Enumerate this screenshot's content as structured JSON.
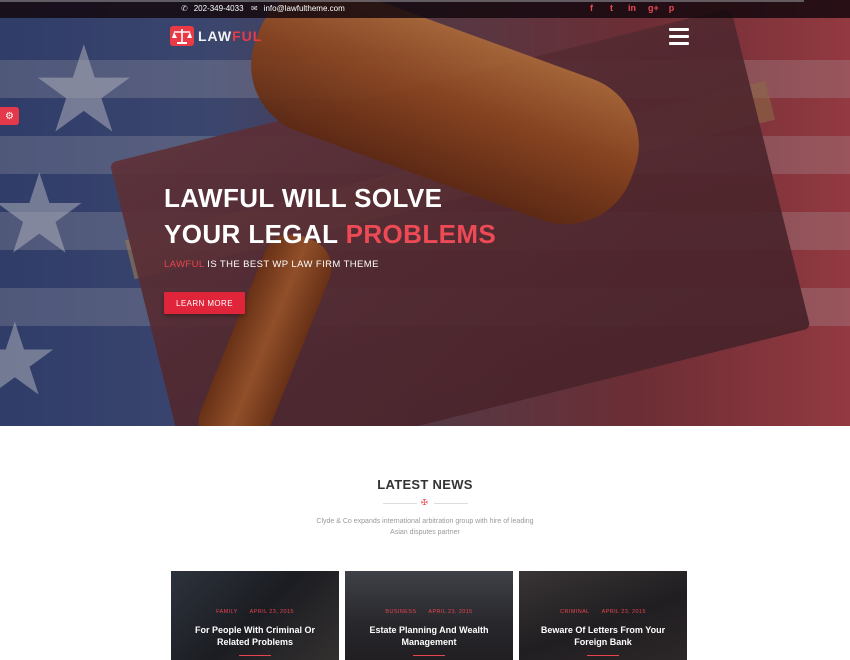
{
  "topbar": {
    "phone": "202-349-4033",
    "phone_icon": "phone-icon",
    "email": "info@lawfultheme.com",
    "email_icon": "envelope-icon",
    "social": [
      {
        "name": "facebook-icon",
        "glyph": "f"
      },
      {
        "name": "twitter-icon",
        "glyph": "t"
      },
      {
        "name": "linkedin-icon",
        "glyph": "in"
      },
      {
        "name": "google-plus-icon",
        "glyph": "g+"
      },
      {
        "name": "pinterest-icon",
        "glyph": "p"
      }
    ]
  },
  "header": {
    "logo_text_a": "LAW",
    "logo_text_b": "FUL",
    "menu_icon": "hamburger-icon"
  },
  "hero": {
    "headline_line1": "LAWFUL WILL SOLVE",
    "headline_line2_a": "YOUR LEGAL ",
    "headline_line2_b": "PROBLEMS",
    "sub_a": "LAWFUL",
    "sub_b": " IS THE BEST WP LAW FIRM THEME",
    "cta": "LEARN MORE"
  },
  "news": {
    "title": "LATEST NEWS",
    "subtitle_line1": "Clyde & Co expands international arbitration group with hire of leading",
    "subtitle_line2": "Asian disputes partner",
    "cards": [
      {
        "category": "FAMILY",
        "date": "APRIL 23, 2015",
        "title": "For People With Criminal Or Related Problems"
      },
      {
        "category": "BUSINESS",
        "date": "APRIL 23, 2015",
        "title": "Estate Planning And Wealth Management"
      },
      {
        "category": "CRIMINAL",
        "date": "APRIL 23, 2015",
        "title": "Beware Of Letters From Your Foreign Bank"
      }
    ]
  },
  "colors": {
    "accent": "#e8434f",
    "button": "#e0243a",
    "topbar": "#140810"
  }
}
